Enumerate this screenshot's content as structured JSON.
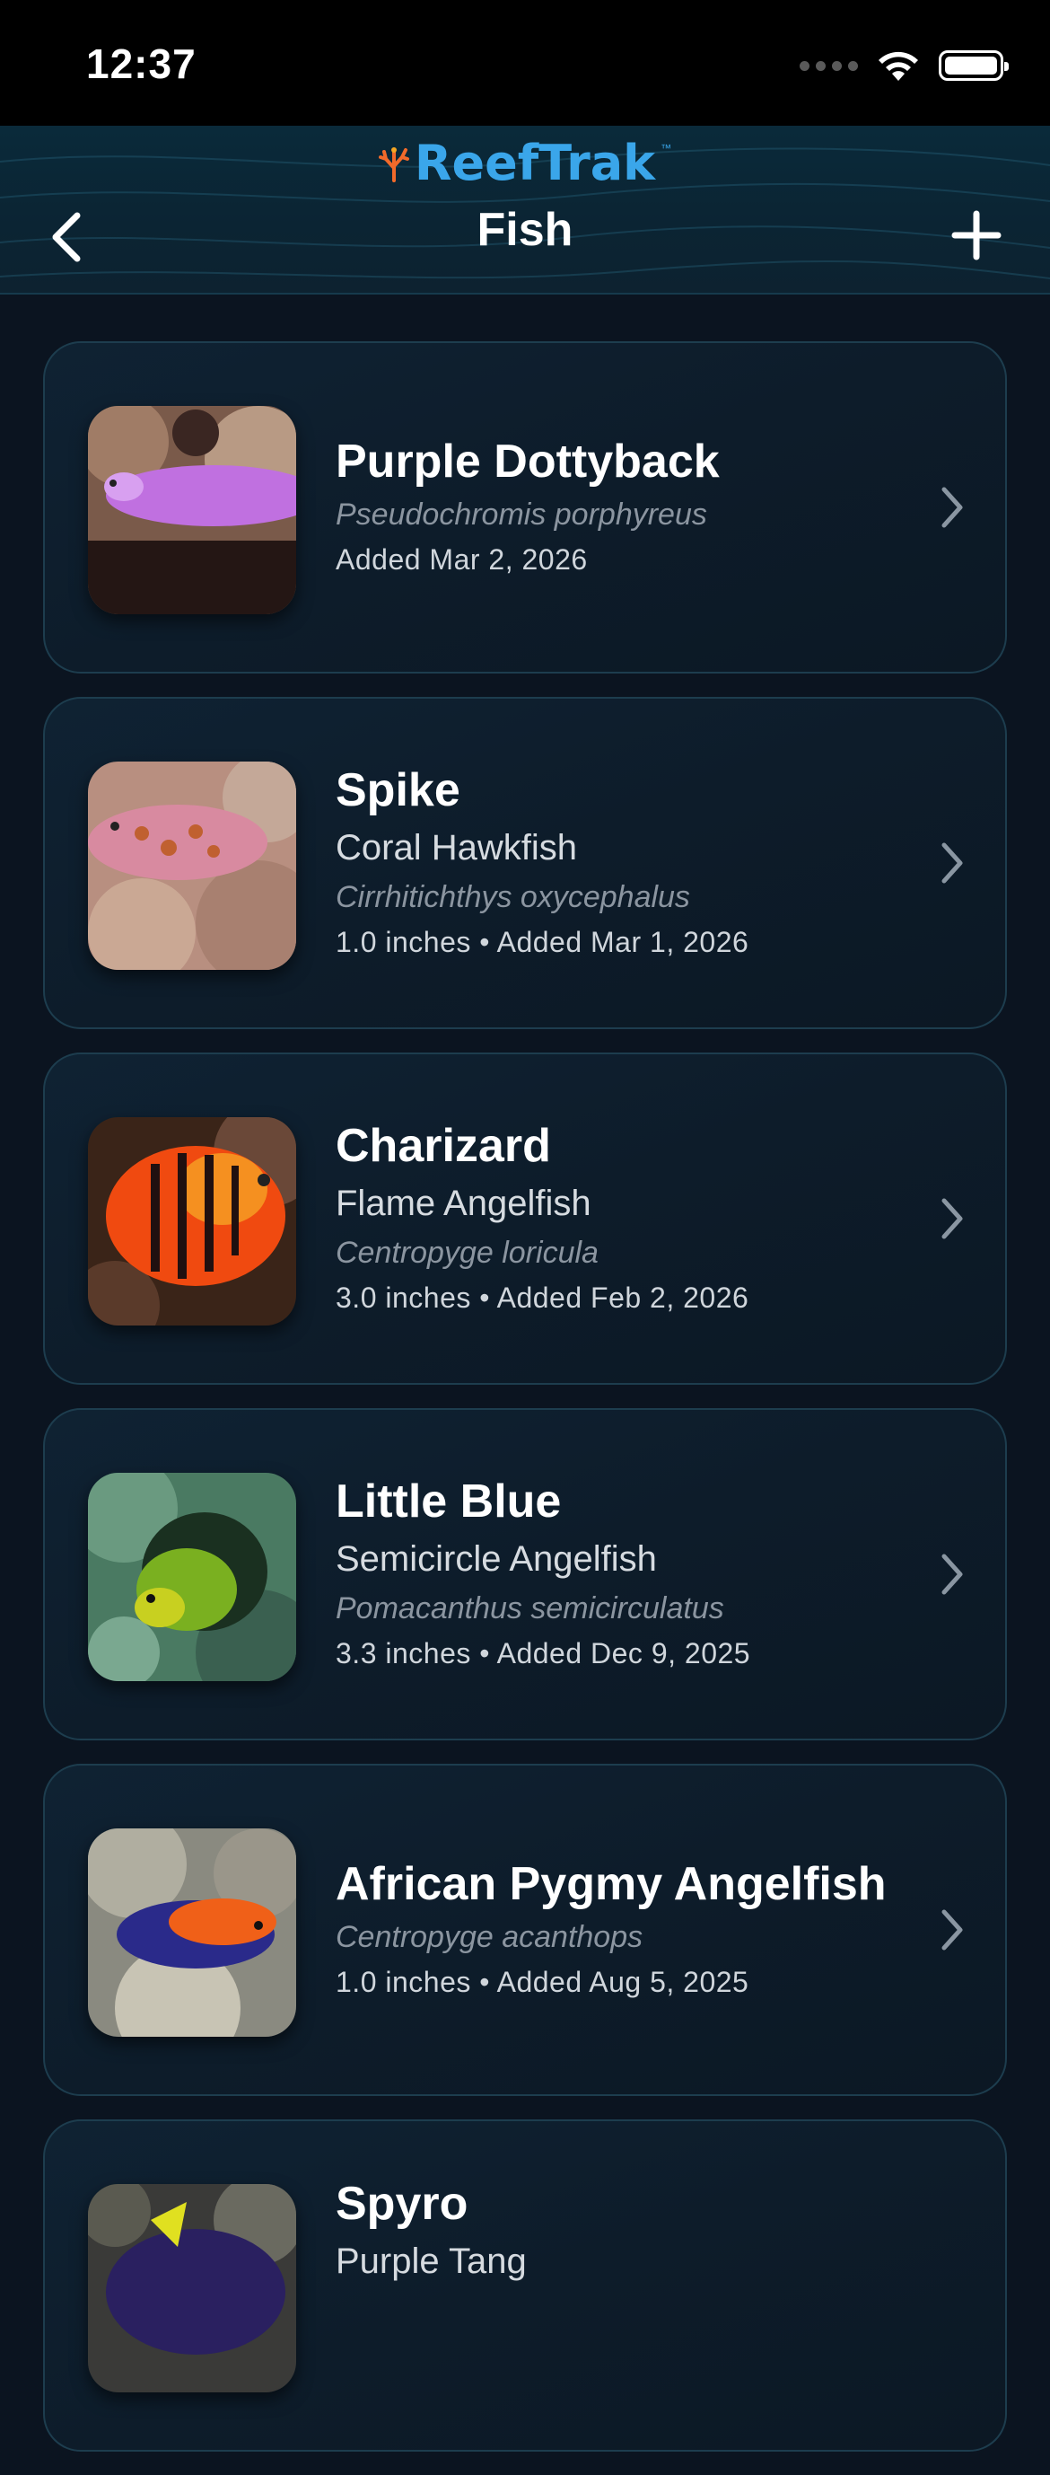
{
  "status_bar": {
    "time": "12:37"
  },
  "nav": {
    "logo": "ReefTrak",
    "logo_tm": "™",
    "title": "Fish"
  },
  "fish": [
    {
      "name": "Purple Dottyback",
      "common": "",
      "scientific": "Pseudochromis porphyreus",
      "meta": "Added Mar 2, 2026",
      "thumb_icon": "purple-dottyback-photo"
    },
    {
      "name": "Spike",
      "common": "Coral Hawkfish",
      "scientific": "Cirrhitichthys oxycephalus",
      "meta": "1.0 inches • Added Mar 1, 2026",
      "thumb_icon": "coral-hawkfish-photo"
    },
    {
      "name": "Charizard",
      "common": "Flame Angelfish",
      "scientific": "Centropyge loricula",
      "meta": "3.0 inches • Added Feb 2, 2026",
      "thumb_icon": "flame-angelfish-photo"
    },
    {
      "name": "Little Blue",
      "common": "Semicircle Angelfish",
      "scientific": "Pomacanthus semicirculatus",
      "meta": "3.3 inches • Added Dec 9, 2025",
      "thumb_icon": "semicircle-angelfish-photo"
    },
    {
      "name": "African Pygmy Angelfish",
      "common": "",
      "scientific": "Centropyge acanthops",
      "meta": "1.0 inches • Added Aug 5, 2025",
      "thumb_icon": "pygmy-angelfish-photo"
    },
    {
      "name": "Spyro",
      "common": "Purple Tang",
      "scientific": "",
      "meta": "",
      "thumb_icon": "purple-tang-photo"
    }
  ]
}
